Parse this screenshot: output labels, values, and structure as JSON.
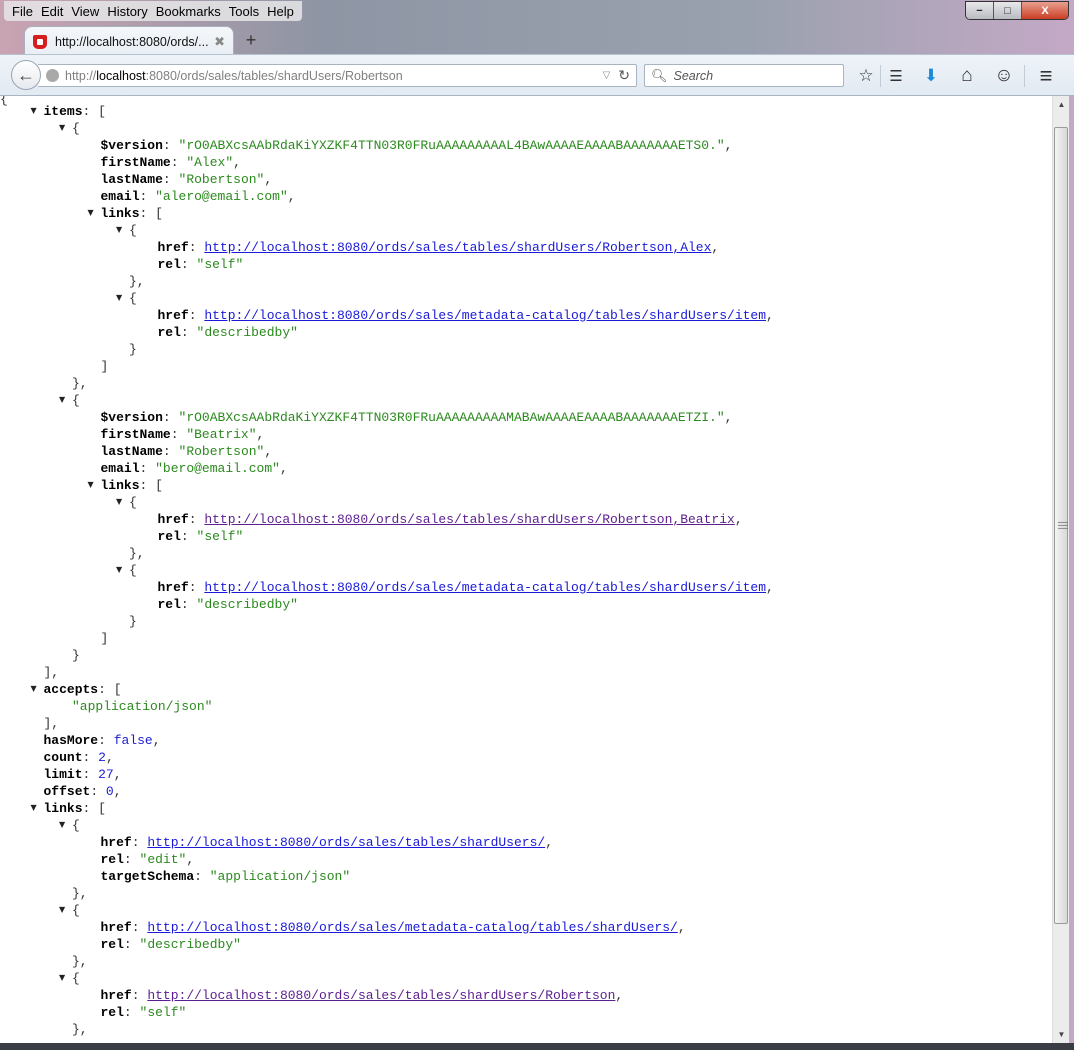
{
  "menubar": {
    "items": [
      "File",
      "Edit",
      "View",
      "History",
      "Bookmarks",
      "Tools",
      "Help"
    ],
    "accelerators": [
      "F",
      "E",
      "V",
      "s",
      "B",
      "T",
      "H"
    ]
  },
  "window_controls": {
    "minimize": "−",
    "maximize": "□",
    "close": "X"
  },
  "tab": {
    "title": "http://localhost:8080/ords/...",
    "close": "✖",
    "new_tab": "+"
  },
  "navbar": {
    "back": "←",
    "url_prefix": "http://",
    "url_host": "localhost",
    "url_rest": ":8080/ords/sales/tables/shardUsers/Robertson",
    "dropmarker": "▽",
    "reload": "↻",
    "search_placeholder": "Search",
    "search_icon": "⌕",
    "icons": {
      "bookmark_star": "☆",
      "reading_list": "☰",
      "downloads": "⬇",
      "home": "⌂",
      "hello": "☺",
      "menu": "≡"
    },
    "download_color": "#1f8ad8"
  },
  "json": {
    "open_brace": "{",
    "items_key": "items",
    "items": [
      {
        "version": "\"rO0ABXcsAAbRdaKiYXZKF4TTN03R0FRuAAAAAAAAAL4BAwAAAAEAAAABAAAAAAAETS0.\"",
        "firstName": "\"Alex\"",
        "lastName": "\"Robertson\"",
        "email": "\"alero@email.com\"",
        "links": [
          {
            "href": "http://localhost:8080/ords/sales/tables/shardUsers/Robertson,Alex",
            "rel": "\"self\"",
            "visited": false
          },
          {
            "href": "http://localhost:8080/ords/sales/metadata-catalog/tables/shardUsers/item",
            "rel": "\"describedby\"",
            "visited": false
          }
        ]
      },
      {
        "version": "\"rO0ABXcsAAbRdaKiYXZKF4TTN03R0FRuAAAAAAAAAMABAwAAAAEAAAABAAAAAAAETZI.\"",
        "firstName": "\"Beatrix\"",
        "lastName": "\"Robertson\"",
        "email": "\"bero@email.com\"",
        "links": [
          {
            "href": "http://localhost:8080/ords/sales/tables/shardUsers/Robertson,Beatrix",
            "rel": "\"self\"",
            "visited": true
          },
          {
            "href": "http://localhost:8080/ords/sales/metadata-catalog/tables/shardUsers/item",
            "rel": "\"describedby\"",
            "visited": false
          }
        ]
      }
    ],
    "accepts_key": "accepts",
    "accepts": [
      "\"application/json\""
    ],
    "hasMore": "false",
    "count": "2",
    "limit": "27",
    "offset": "0",
    "links_key": "links",
    "links": [
      {
        "href": "http://localhost:8080/ords/sales/tables/shardUsers/",
        "rel": "\"edit\"",
        "targetSchema": "\"application/json\"",
        "visited": false
      },
      {
        "href": "http://localhost:8080/ords/sales/metadata-catalog/tables/shardUsers/",
        "rel": "\"describedby\"",
        "visited": false
      },
      {
        "href": "http://localhost:8080/ords/sales/tables/shardUsers/Robertson",
        "rel": "\"self\"",
        "visited": true
      }
    ]
  },
  "colors": {
    "string": "#2b8a1e",
    "number": "#1c1cd4",
    "link": "#1a1ad8",
    "visited_link": "#5b1f8f"
  }
}
